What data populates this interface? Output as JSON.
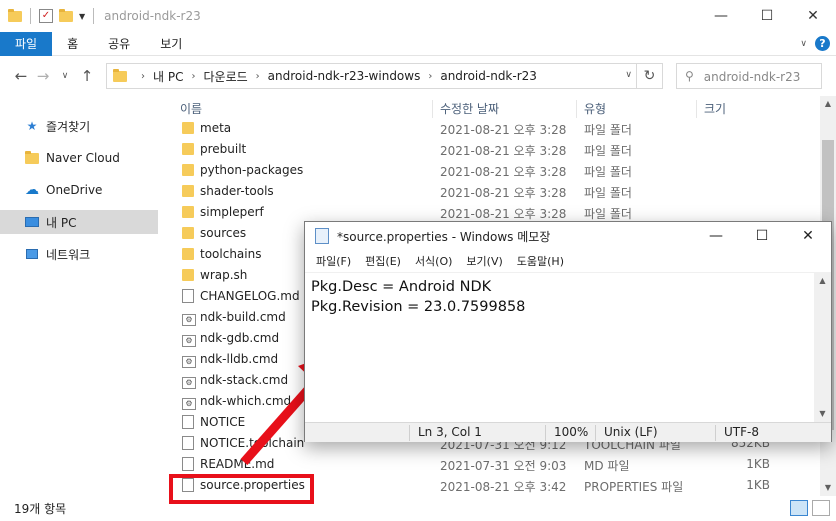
{
  "explorer": {
    "title": "android-ndk-r23",
    "window_buttons": {
      "minimize": "—",
      "maximize": "☐",
      "close": "✕"
    },
    "ribbon": {
      "tabs": [
        "파일",
        "홈",
        "공유",
        "보기"
      ],
      "help": "?"
    },
    "breadcrumb": [
      "내 PC",
      "다운로드",
      "android-ndk-r23-windows",
      "android-ndk-r23"
    ],
    "search_placeholder": "android-ndk-r23 검색",
    "nav": [
      {
        "label": "즐겨찾기"
      },
      {
        "label": "Naver Cloud"
      },
      {
        "label": "OneDrive"
      },
      {
        "label": "내 PC"
      },
      {
        "label": "네트워크"
      }
    ],
    "columns": {
      "name": "이름",
      "date": "수정한 날짜",
      "type": "유형",
      "size": "크기"
    },
    "rows": [
      {
        "name": "meta",
        "date": "2021-08-21 오후 3:28",
        "type": "파일 폴더",
        "size": "",
        "kind": "folder"
      },
      {
        "name": "prebuilt",
        "date": "2021-08-21 오후 3:28",
        "type": "파일 폴더",
        "size": "",
        "kind": "folder"
      },
      {
        "name": "python-packages",
        "date": "2021-08-21 오후 3:28",
        "type": "파일 폴더",
        "size": "",
        "kind": "folder"
      },
      {
        "name": "shader-tools",
        "date": "2021-08-21 오후 3:28",
        "type": "파일 폴더",
        "size": "",
        "kind": "folder"
      },
      {
        "name": "simpleperf",
        "date": "2021-08-21 오후 3:28",
        "type": "파일 폴더",
        "size": "",
        "kind": "folder"
      },
      {
        "name": "sources",
        "date": "",
        "type": "",
        "size": "",
        "kind": "folder"
      },
      {
        "name": "toolchains",
        "date": "",
        "type": "",
        "size": "",
        "kind": "folder"
      },
      {
        "name": "wrap.sh",
        "date": "",
        "type": "",
        "size": "",
        "kind": "folder"
      },
      {
        "name": "CHANGELOG.md",
        "date": "",
        "type": "",
        "size": "",
        "kind": "doc"
      },
      {
        "name": "ndk-build.cmd",
        "date": "",
        "type": "",
        "size": "",
        "kind": "cmd"
      },
      {
        "name": "ndk-gdb.cmd",
        "date": "",
        "type": "",
        "size": "",
        "kind": "cmd"
      },
      {
        "name": "ndk-lldb.cmd",
        "date": "",
        "type": "",
        "size": "",
        "kind": "cmd"
      },
      {
        "name": "ndk-stack.cmd",
        "date": "",
        "type": "",
        "size": "",
        "kind": "cmd"
      },
      {
        "name": "ndk-which.cmd",
        "date": "",
        "type": "",
        "size": "",
        "kind": "cmd"
      },
      {
        "name": "NOTICE",
        "date": "",
        "type": "",
        "size": "",
        "kind": "doc"
      },
      {
        "name": "NOTICE.toolchain",
        "date": "2021-07-31 오전 9:12",
        "type": "TOOLCHAIN 파일",
        "size": "852KB",
        "kind": "doc"
      },
      {
        "name": "README.md",
        "date": "2021-07-31 오전 9:03",
        "type": "MD 파일",
        "size": "1KB",
        "kind": "doc"
      },
      {
        "name": "source.properties",
        "date": "2021-08-21 오후 3:42",
        "type": "PROPERTIES 파일",
        "size": "1KB",
        "kind": "doc"
      }
    ],
    "status": "19개 항목"
  },
  "notepad": {
    "title": "*source.properties - Windows 메모장",
    "menu": [
      "파일(F)",
      "편집(E)",
      "서식(O)",
      "보기(V)",
      "도움말(H)"
    ],
    "lines": [
      "Pkg.Desc = Android NDK",
      "Pkg.Revision = 23.0.7599858"
    ],
    "status": {
      "position": "Ln 3, Col 1",
      "zoom": "100%",
      "eol": "Unix (LF)",
      "encoding": "UTF-8"
    }
  },
  "colors": {
    "accent": "#1979ca",
    "annotation_red": "#e8101a",
    "folder": "#f6cb5a"
  }
}
